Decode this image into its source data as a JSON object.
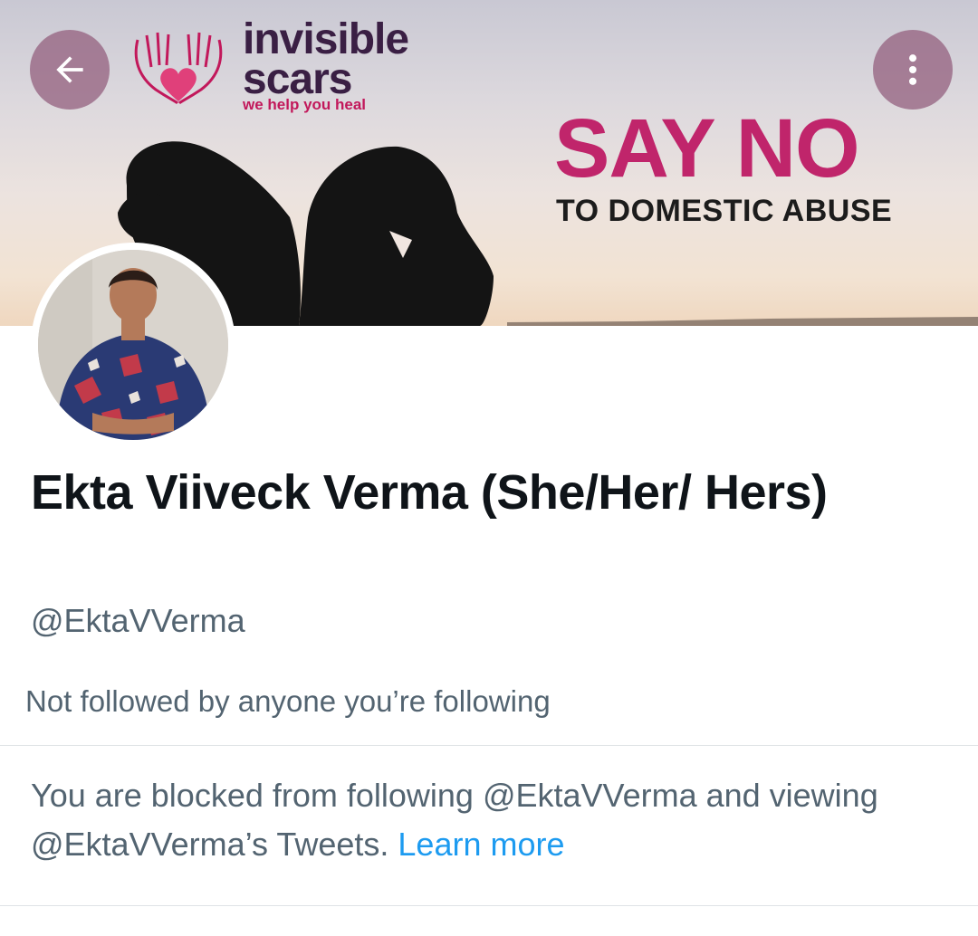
{
  "banner": {
    "logo": {
      "line1": "invisible",
      "line2": "scars",
      "tagline": "we help you heal"
    },
    "headline": "SAY NO",
    "subheadline": "TO DOMESTIC ABUSE"
  },
  "nav": {
    "back_icon": "arrow-left-icon",
    "more_icon": "more-vertical-icon"
  },
  "profile": {
    "display_name": "Ekta Viiveck Verma (She/Her/ Hers)",
    "handle": "@EktaVVerma",
    "followed_by": "Not followed by anyone you’re following"
  },
  "blocked_notice": {
    "text": "You are blocked from following @EktaVVerma and viewing @EktaVVerma’s Tweets.",
    "link_label": "Learn more"
  },
  "colors": {
    "link": "#1d9bf0",
    "secondary_text": "#536471",
    "brand_pink": "#c0256b",
    "nav_button": "#96648299"
  }
}
